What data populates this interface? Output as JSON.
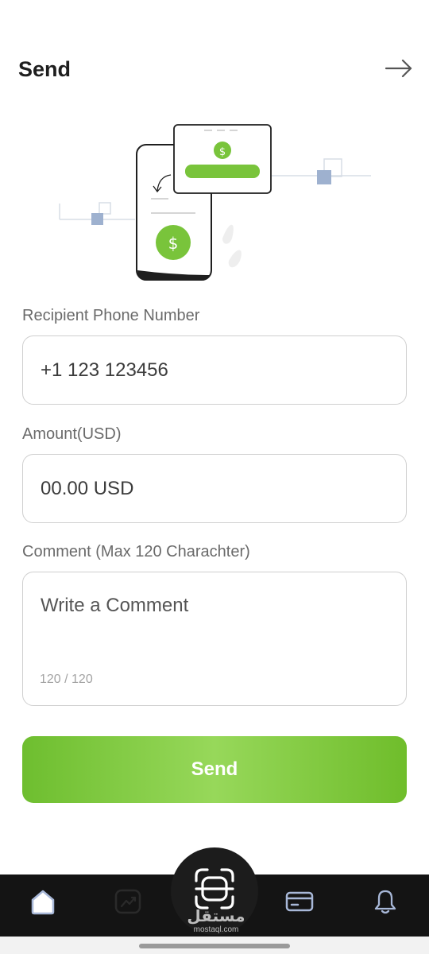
{
  "header": {
    "title": "Send",
    "forward_icon": "arrow-right-icon"
  },
  "illustration": {
    "currency_symbol": "$"
  },
  "form": {
    "phone": {
      "label": "Recipient Phone Number",
      "value": "+1 123 123456"
    },
    "amount": {
      "label": "Amount(USD)",
      "placeholder": "00.00 USD"
    },
    "comment": {
      "label": "Comment (Max 120 Charachter)",
      "placeholder": "Write a Comment",
      "counter": "120 / 120"
    },
    "send_label": "Send"
  },
  "bottom_nav": {
    "items": [
      {
        "name": "home",
        "icon": "home-icon"
      },
      {
        "name": "stats",
        "icon": "chart-icon"
      },
      {
        "name": "scan",
        "icon": "scan-icon"
      },
      {
        "name": "cards",
        "icon": "card-icon"
      },
      {
        "name": "notifications",
        "icon": "bell-icon"
      }
    ]
  },
  "watermark": {
    "arabic": "مستقل",
    "latin": "mostaql.com"
  },
  "colors": {
    "accent_green": "#78c53a",
    "nav_background": "#141414",
    "illustration_blue": "#9eb1cf"
  }
}
